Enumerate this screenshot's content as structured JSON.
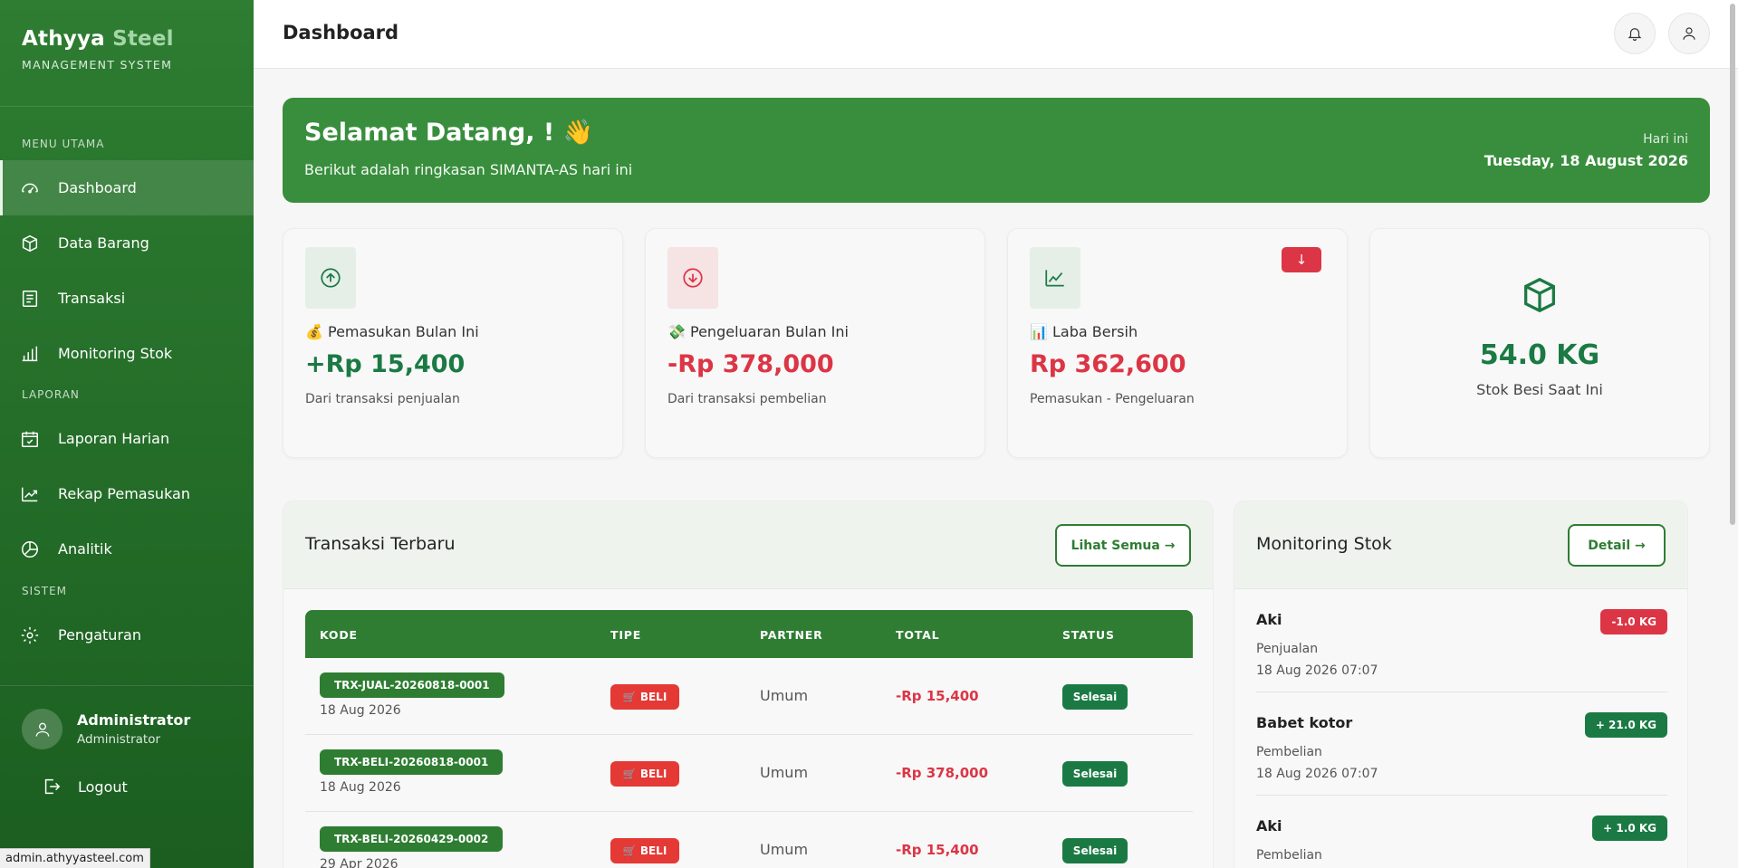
{
  "sidebar": {
    "brand_name": "Athyya",
    "brand_accent": "Steel",
    "brand_sub": "MANAGEMENT SYSTEM",
    "section_main": "MENU UTAMA",
    "section_report": "LAPORAN",
    "section_system": "SISTEM",
    "items": {
      "dashboard": "Dashboard",
      "data_barang": "Data Barang",
      "transaksi": "Transaksi",
      "monitoring": "Monitoring Stok",
      "laporan_harian": "Laporan Harian",
      "rekap": "Rekap Pemasukan",
      "analitik": "Analitik",
      "pengaturan": "Pengaturan"
    },
    "user_name": "Administrator",
    "user_role": "Administrator",
    "logout": "Logout"
  },
  "status_url": "admin.athyyasteel.com",
  "topbar": {
    "title": "Dashboard"
  },
  "welcome": {
    "title": "Selamat Datang, ! 👋",
    "subtitle": "Berikut adalah ringkasan SIMANTA-AS hari ini",
    "today_label": "Hari ini",
    "today_value": "Tuesday, 18 August 2026"
  },
  "stats": {
    "income": {
      "title": "💰 Pemasukan Bulan Ini",
      "value": "+Rp 15,400",
      "desc": "Dari transaksi penjualan"
    },
    "expense": {
      "title": "💸 Pengeluaran Bulan Ini",
      "value": "-Rp 378,000",
      "desc": "Dari transaksi pembelian"
    },
    "profit": {
      "title": "📊 Laba Bersih",
      "value": "Rp 362,600",
      "desc": "Pemasukan - Pengeluaran",
      "trend": "↓"
    },
    "stock": {
      "value": "54.0 KG",
      "desc": "Stok Besi Saat Ini"
    }
  },
  "transactions": {
    "title": "Transaksi Terbaru",
    "see_all": "Lihat Semua →",
    "headers": {
      "kode": "KODE",
      "tipe": "TIPE",
      "partner": "PARTNER",
      "total": "TOTAL",
      "status": "STATUS"
    },
    "rows": [
      {
        "code": "TRX-JUAL-20260818-0001",
        "date": "18 Aug 2026",
        "type": "🛒 BELI",
        "partner": "Umum",
        "total": "-Rp 15,400",
        "status": "Selesai"
      },
      {
        "code": "TRX-BELI-20260818-0001",
        "date": "18 Aug 2026",
        "type": "🛒 BELI",
        "partner": "Umum",
        "total": "-Rp 378,000",
        "status": "Selesai"
      },
      {
        "code": "TRX-BELI-20260429-0002",
        "date": "29 Apr 2026",
        "type": "🛒 BELI",
        "partner": "Umum",
        "total": "-Rp 15,400",
        "status": "Selesai"
      }
    ]
  },
  "monitoring": {
    "title": "Monitoring Stok",
    "detail": "Detail →",
    "items": [
      {
        "name": "Aki",
        "type": "Penjualan",
        "date": "18 Aug 2026 07:07",
        "qty": "-1.0 KG",
        "color": "#dc3545"
      },
      {
        "name": "Babet kotor",
        "type": "Pembelian",
        "date": "18 Aug 2026 07:07",
        "qty": "+ 21.0 KG",
        "color": "#1b7a44"
      },
      {
        "name": "Aki",
        "type": "Pembelian",
        "date": "",
        "qty": "+ 1.0 KG",
        "color": "#1b7a44"
      }
    ]
  },
  "colors": {
    "primary": "#2e7d32",
    "success": "#1b7a44",
    "danger": "#dc3545"
  }
}
